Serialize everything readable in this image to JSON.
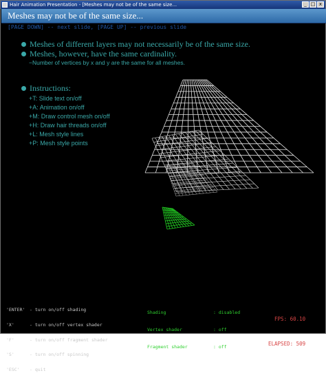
{
  "window": {
    "title": "Hair Animation Presentation - [Meshes may not be of the same size...",
    "buttons": [
      "_",
      "□",
      "x"
    ]
  },
  "slide": {
    "title": "Meshes may not be of the same size...",
    "nav": "[PAGE DOWN] -- next slide, [PAGE UP] -- previous slide",
    "bullets": [
      "Meshes of different layers may not necessarily be of the same size.",
      "Meshes, however, have the same cardinality."
    ],
    "subbullet": "−Number of vertices by x and y are the same for all meshes.",
    "instructions_title": "Instructions:",
    "instructions": [
      "+T: Slide text on/off",
      "+A: Animation on/off",
      "+M: Draw control mesh on/off",
      "+H: Draw hair threads on/off",
      "+L: Mesh style lines",
      "+P: Mesh style points"
    ]
  },
  "footer": {
    "keys": [
      {
        "key": "'ENTER'",
        "desc": "- turn on/off shading"
      },
      {
        "key": "'X'",
        "desc": "- turn on/off vertex shader"
      },
      {
        "key": "'F'",
        "desc": "- turn on/off fragment shader"
      },
      {
        "key": "'S'",
        "desc": "- turn on/off spinning"
      },
      {
        "key": "'ESC'",
        "desc": "- quit"
      }
    ],
    "status": [
      {
        "label": "Shading",
        "value": ": disabled"
      },
      {
        "label": "Vertex shader",
        "value": ": off"
      },
      {
        "label": "Fragment shader",
        "value": ": off"
      }
    ],
    "fps": "FPS: 60.10",
    "elapsed": "ELAPSED: 509"
  },
  "colors": {
    "mesh_front": "#e8e8e8",
    "mesh_back": "#22cc22",
    "text_cyan": "#3aa8a8",
    "nav_blue": "#1e55a5"
  }
}
